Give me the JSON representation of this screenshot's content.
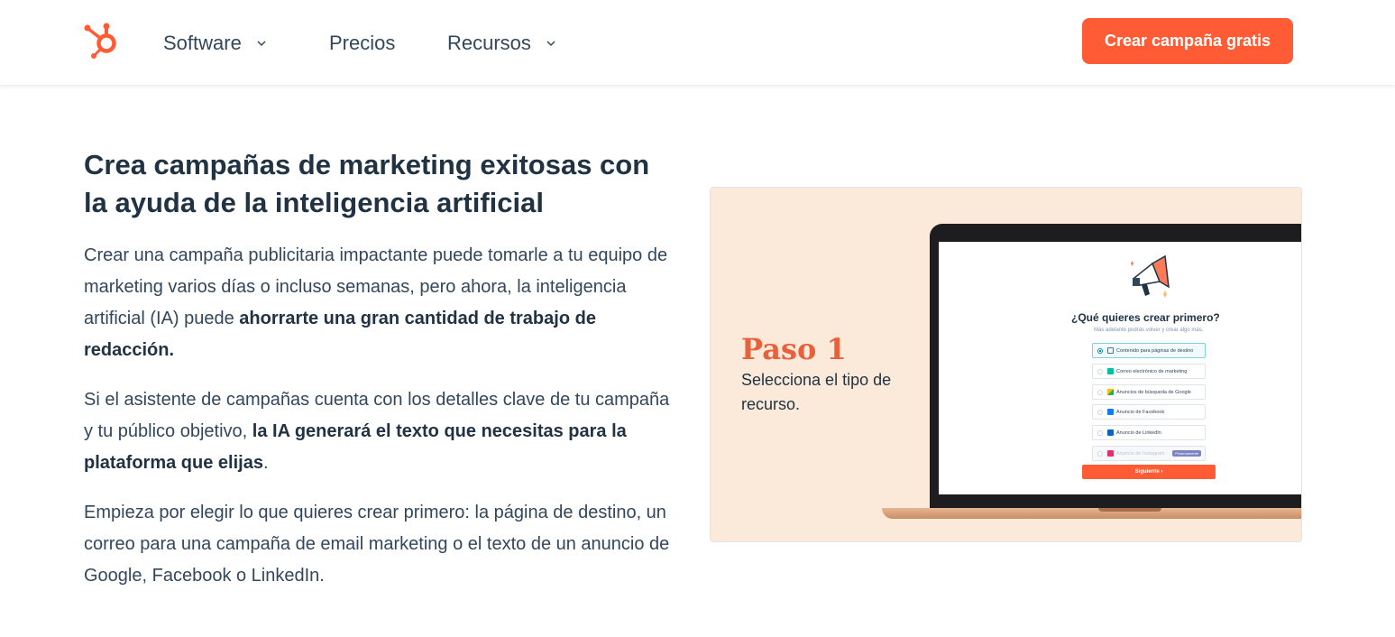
{
  "header": {
    "nav": [
      {
        "label": "Software",
        "has_dropdown": true
      },
      {
        "label": "Precios",
        "has_dropdown": false
      },
      {
        "label": "Recursos",
        "has_dropdown": true
      }
    ],
    "cta_label": "Crear campaña gratis"
  },
  "main": {
    "headline": "Crea campañas de marketing exitosas con la ayuda de la inteligencia artificial",
    "p1": {
      "text": "Crear una campaña publicitaria impactante puede tomarle a tu equipo de marketing varios días o incluso semanas, pero ahora, la inteligencia artificial (IA) puede ",
      "bold": "ahorrarte una gran cantidad de trabajo de redacción."
    },
    "p2": {
      "text": "Si el asistente de campañas cuenta con los detalles clave de tu campaña y tu público objetivo, ",
      "bold": "la IA generará el texto que necesitas para la plataforma que elijas",
      "tail": "."
    },
    "p3": {
      "text": "Empieza por elegir lo que quieres crear primero: la página de destino, un correo para una campaña de email marketing o el texto de un anuncio de Google, Facebook o LinkedIn."
    }
  },
  "illustration": {
    "step_title": "Paso 1",
    "step_subtitle": "Selecciona el tipo de recurso.",
    "screen_question": "¿Qué quieres crear primero?",
    "screen_hint": "Más adelante podrás volver y crear algo más.",
    "options": [
      {
        "label": "Contenido para páginas de destino",
        "icon": "page-icon",
        "selected": true
      },
      {
        "label": "Correo electrónico de marketing",
        "icon": "email-icon",
        "selected": false
      },
      {
        "label": "Anuncios de búsqueda de Google",
        "icon": "google-ads-icon",
        "selected": false
      },
      {
        "label": "Anuncio de Facebook",
        "icon": "facebook-icon",
        "selected": false
      },
      {
        "label": "Anuncio de LinkedIn",
        "icon": "linkedin-icon",
        "selected": false
      },
      {
        "label": "Anuncio de Instagram",
        "icon": "instagram-icon",
        "selected": false,
        "disabled": true,
        "pill": "Próximamente"
      }
    ],
    "next_label": "Siguiente  ›"
  },
  "colors": {
    "accent": "#ff5c35",
    "text_dark": "#213343",
    "text_body": "#33475b",
    "card_bg": "#fbe9d9"
  }
}
